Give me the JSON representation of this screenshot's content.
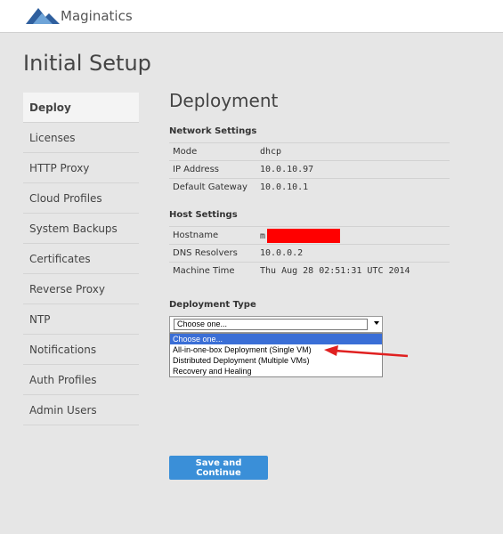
{
  "header": {
    "logo_text": "Maginatics",
    "logo_icon": "mountain-logo-icon"
  },
  "page_title": "Initial Setup",
  "nav": {
    "items": [
      {
        "label": "Deploy",
        "active": true
      },
      {
        "label": "Licenses"
      },
      {
        "label": "HTTP Proxy"
      },
      {
        "label": "Cloud Profiles"
      },
      {
        "label": "System Backups"
      },
      {
        "label": "Certificates"
      },
      {
        "label": "Reverse Proxy"
      },
      {
        "label": "NTP"
      },
      {
        "label": "Notifications"
      },
      {
        "label": "Auth Profiles"
      },
      {
        "label": "Admin Users"
      }
    ]
  },
  "main": {
    "title": "Deployment",
    "network": {
      "title": "Network Settings",
      "rows": [
        {
          "key": "Mode",
          "value": "dhcp"
        },
        {
          "key": "IP Address",
          "value": "10.0.10.97"
        },
        {
          "key": "Default Gateway",
          "value": "10.0.10.1"
        }
      ]
    },
    "host": {
      "title": "Host Settings",
      "rows": [
        {
          "key": "Hostname",
          "value": "m"
        },
        {
          "key": "DNS Resolvers",
          "value": "10.0.0.2"
        },
        {
          "key": "Machine Time",
          "value": "Thu Aug 28 02:51:31 UTC 2014"
        }
      ]
    },
    "deployment_type": {
      "label": "Deployment Type",
      "selected": "Choose one...",
      "options": [
        "Choose one...",
        "All-in-one-box Deployment (Single VM)",
        "Distributed Deployment (Multiple VMs)",
        "Recovery and Healing"
      ]
    },
    "save_label": "Save and Continue"
  },
  "colors": {
    "accent": "#3a8fd8",
    "highlight": "#3a6ed6",
    "annotation": "#e02020"
  }
}
